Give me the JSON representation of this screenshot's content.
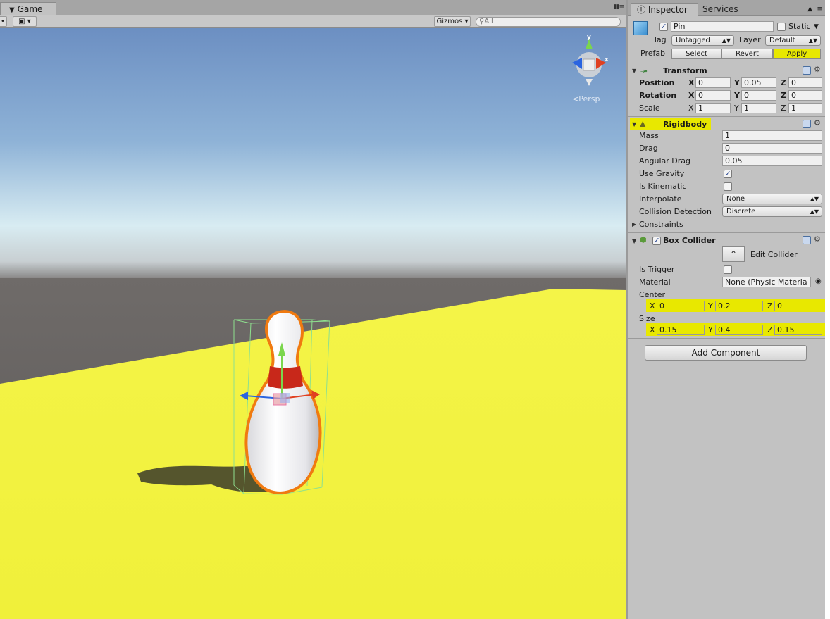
{
  "scene": {
    "tab_label": "Game",
    "gizmos_label": "Gizmos",
    "search_placeholder": "All",
    "persp_label": "Persp",
    "axis_y": "y",
    "axis_x": "x"
  },
  "inspector": {
    "tabs": {
      "inspector": "Inspector",
      "services": "Services"
    },
    "header": {
      "name": "Pin",
      "static_label": "Static",
      "tag_label": "Tag",
      "tag_value": "Untagged",
      "layer_label": "Layer",
      "layer_value": "Default",
      "prefab_label": "Prefab",
      "select": "Select",
      "revert": "Revert",
      "apply": "Apply"
    },
    "transform": {
      "title": "Transform",
      "position_label": "Position",
      "rotation_label": "Rotation",
      "scale_label": "Scale",
      "position": {
        "x": "0",
        "y": "0.05",
        "z": "0"
      },
      "rotation": {
        "x": "0",
        "y": "0",
        "z": "0"
      },
      "scale": {
        "x": "1",
        "y": "1",
        "z": "1"
      }
    },
    "rigidbody": {
      "title": "Rigidbody",
      "mass_label": "Mass",
      "mass": "1",
      "drag_label": "Drag",
      "drag": "0",
      "angular_drag_label": "Angular Drag",
      "angular_drag": "0.05",
      "use_gravity_label": "Use Gravity",
      "use_gravity": true,
      "is_kinematic_label": "Is Kinematic",
      "is_kinematic": false,
      "interpolate_label": "Interpolate",
      "interpolate": "None",
      "collision_label": "Collision Detection",
      "collision": "Discrete",
      "constraints_label": "Constraints"
    },
    "box_collider": {
      "title": "Box Collider",
      "edit_collider": "Edit Collider",
      "is_trigger_label": "Is Trigger",
      "is_trigger": false,
      "material_label": "Material",
      "material": "None (Physic Materia",
      "center_label": "Center",
      "center": {
        "x": "0",
        "y": "0.2",
        "z": "0"
      },
      "size_label": "Size",
      "size": {
        "x": "0.15",
        "y": "0.4",
        "z": "0.15"
      }
    },
    "add_component": "Add Component",
    "axis_letters": {
      "x": "X",
      "y": "Y",
      "z": "Z"
    }
  },
  "colors": {
    "highlight": "#e8e800",
    "floor": "#f0f040",
    "pin_outline": "#f07a10",
    "pin_stripe": "#c8281a"
  }
}
